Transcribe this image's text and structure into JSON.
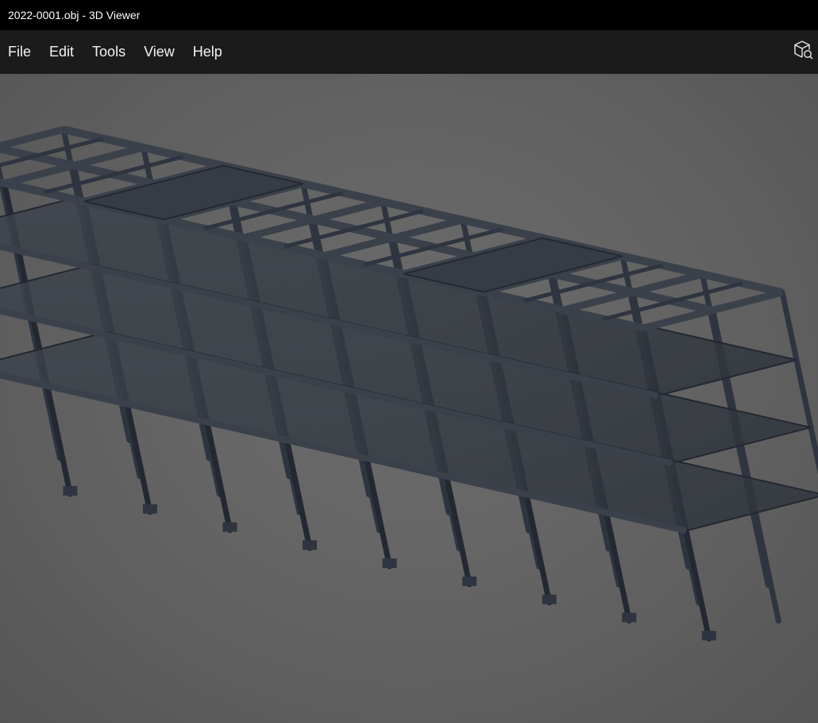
{
  "window": {
    "title": "2022-0001.obj - 3D Viewer"
  },
  "menu": {
    "items": [
      {
        "label": "File"
      },
      {
        "label": "Edit"
      },
      {
        "label": "Tools"
      },
      {
        "label": "View"
      },
      {
        "label": "Help"
      }
    ]
  },
  "toolbar": {
    "inspect_icon": "3d-object-search-icon"
  },
  "viewport": {
    "model_icon": "building-frame-model",
    "background_color": "#656565",
    "model_color": "#2e333d"
  }
}
